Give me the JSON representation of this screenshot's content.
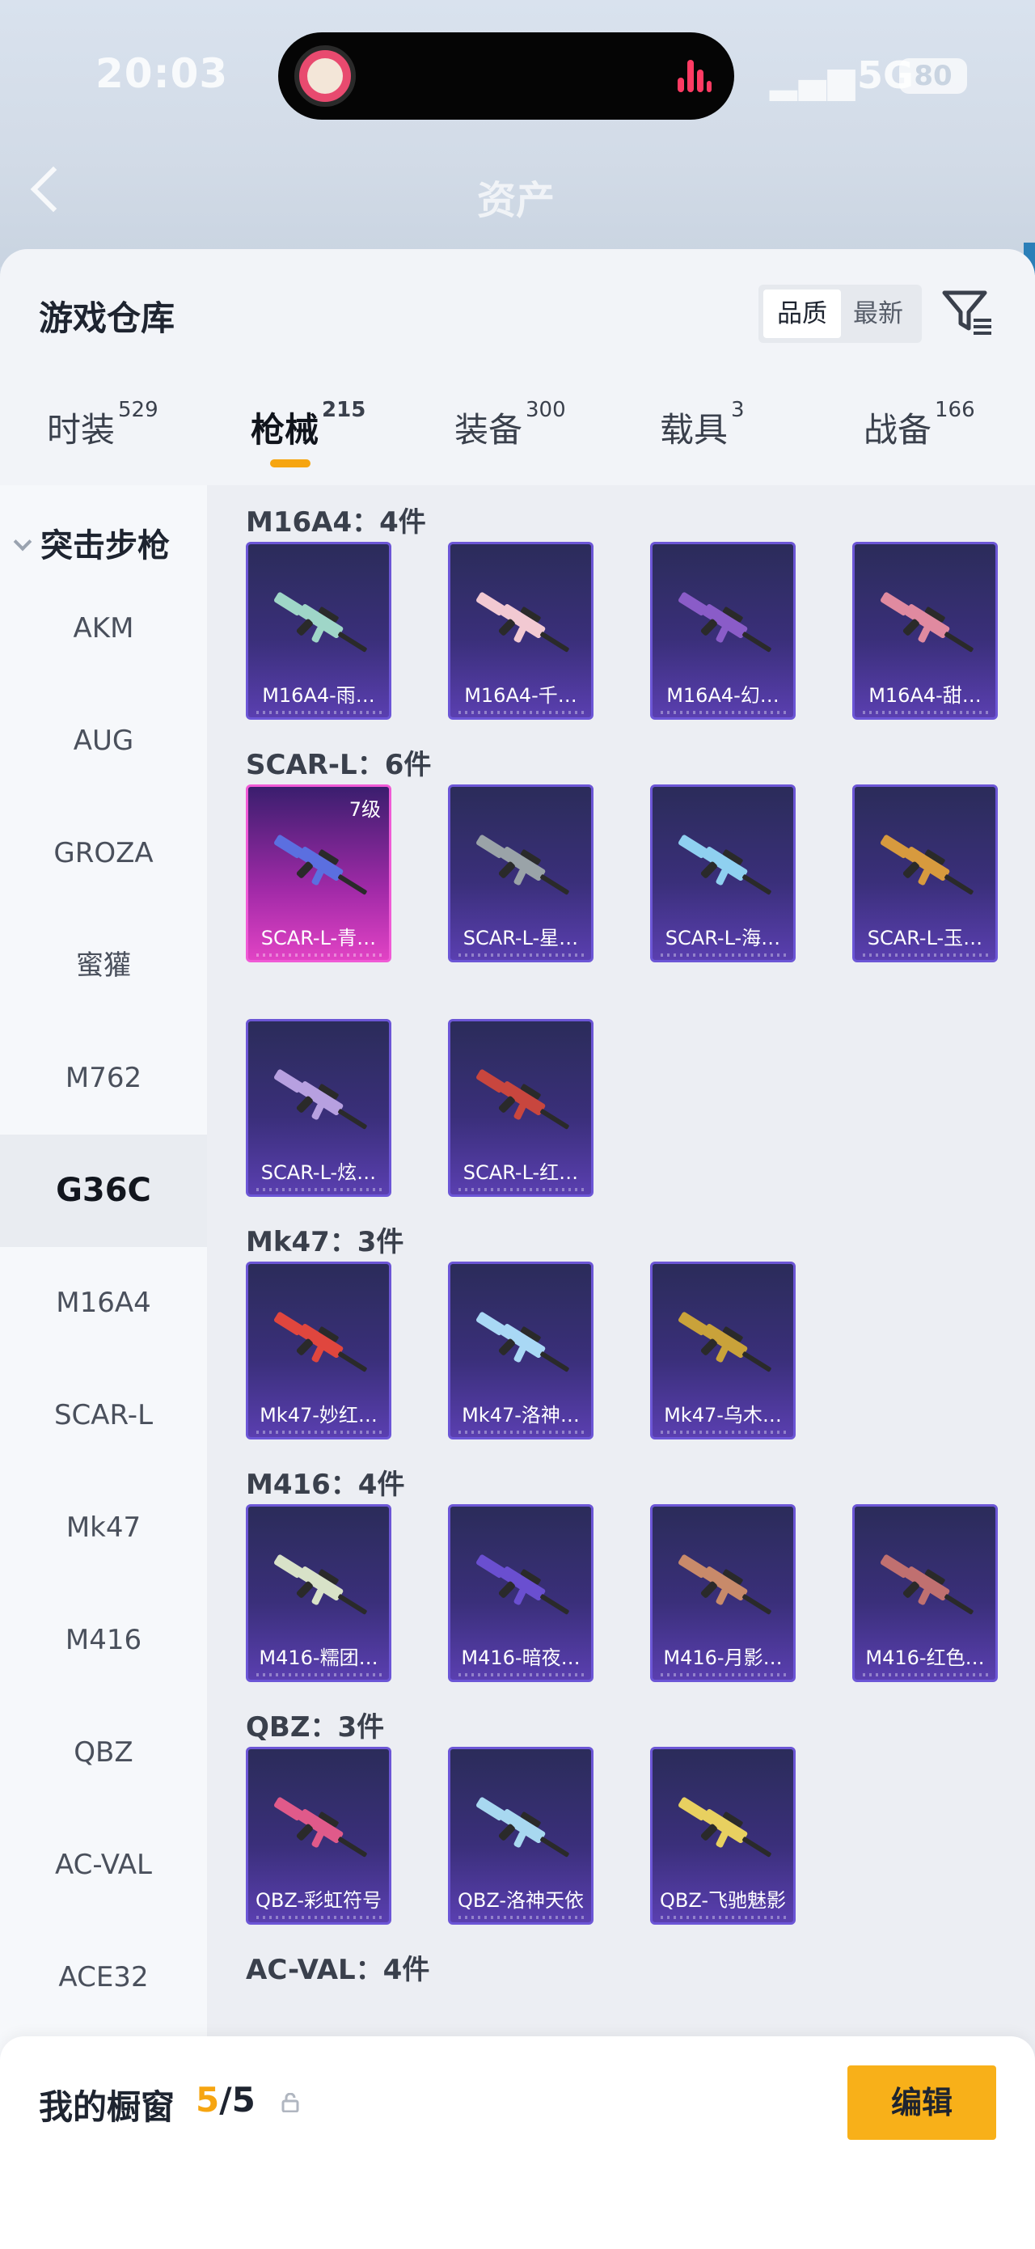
{
  "status": {
    "time": "20:03",
    "network": "5G",
    "battery": "80"
  },
  "header": {
    "ghost_title": "资产"
  },
  "warehouse": {
    "title": "游戏仓库",
    "sort": {
      "options": [
        "品质",
        "最新"
      ],
      "selected": "品质"
    },
    "filter_icon": "filter-list-icon"
  },
  "tabs": [
    {
      "label": "时装",
      "count": "529"
    },
    {
      "label": "枪械",
      "count": "215",
      "active": true
    },
    {
      "label": "装备",
      "count": "300"
    },
    {
      "label": "载具",
      "count": "3"
    },
    {
      "label": "战备",
      "count": "166"
    }
  ],
  "sidebar": {
    "category": "突击步枪",
    "items": [
      {
        "label": "AKM"
      },
      {
        "label": "AUG"
      },
      {
        "label": "GROZA"
      },
      {
        "label": "蜜獾"
      },
      {
        "label": "M762"
      },
      {
        "label": "G36C",
        "active": true
      },
      {
        "label": "M16A4"
      },
      {
        "label": "SCAR-L"
      },
      {
        "label": "Mk47"
      },
      {
        "label": "M416"
      },
      {
        "label": "QBZ"
      },
      {
        "label": "AC-VAL"
      },
      {
        "label": "ACE32"
      }
    ]
  },
  "sections": [
    {
      "title": "M16A4：4件",
      "items": [
        {
          "name": "M16A4-雨…",
          "gun_color": "#9fd6c8"
        },
        {
          "name": "M16A4-千…",
          "gun_color": "#f2c9d2"
        },
        {
          "name": "M16A4-幻…",
          "gun_color": "#8a5cc8"
        },
        {
          "name": "M16A4-甜…",
          "gun_color": "#e08aa0"
        }
      ]
    },
    {
      "title": "SCAR-L：6件",
      "items": [
        {
          "name": "SCAR-L-青…",
          "gun_color": "#5b6fe0",
          "level": "7级",
          "highlight": true
        },
        {
          "name": "SCAR-L-星…",
          "gun_color": "#9aa3a8"
        },
        {
          "name": "SCAR-L-海…",
          "gun_color": "#8fd0f0"
        },
        {
          "name": "SCAR-L-玉…",
          "gun_color": "#d79a3e"
        },
        {
          "name": "SCAR-L-炫…",
          "gun_color": "#b7a0e0"
        },
        {
          "name": "SCAR-L-红…",
          "gun_color": "#c8463e"
        }
      ]
    },
    {
      "title": "Mk47：3件",
      "items": [
        {
          "name": "Mk47-妙红…",
          "gun_color": "#e0463e"
        },
        {
          "name": "Mk47-洛神…",
          "gun_color": "#a9d8f5"
        },
        {
          "name": "Mk47-乌木…",
          "gun_color": "#c9a23a"
        }
      ]
    },
    {
      "title": "M416：4件",
      "items": [
        {
          "name": "M416-糯团…",
          "gun_color": "#d8e2c8"
        },
        {
          "name": "M416-暗夜…",
          "gun_color": "#6a4fd0"
        },
        {
          "name": "M416-月影…",
          "gun_color": "#c88a6a"
        },
        {
          "name": "M416-红色…",
          "gun_color": "#c07070"
        }
      ]
    },
    {
      "title": "QBZ：3件",
      "items": [
        {
          "name": "QBZ-彩虹符号",
          "gun_color": "#e05a8a"
        },
        {
          "name": "QBZ-洛神天依",
          "gun_color": "#a8d8f0"
        },
        {
          "name": "QBZ-飞驰魅影",
          "gun_color": "#e8d060"
        }
      ]
    },
    {
      "title": "AC-VAL：4件",
      "items": []
    }
  ],
  "showcase": {
    "label": "我的橱窗",
    "current": "5",
    "total": "/5",
    "edit_label": "编辑"
  },
  "colors": {
    "accent": "#f8b019",
    "card_border": "#6c56d6",
    "highlight_card": "#e143c4"
  }
}
